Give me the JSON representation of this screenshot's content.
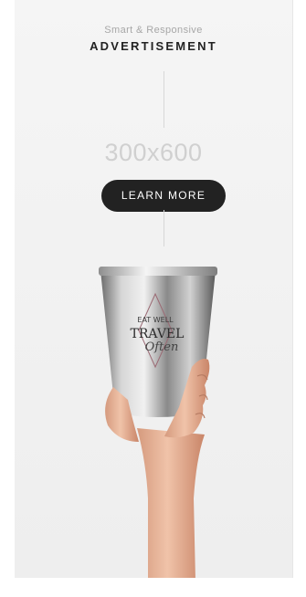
{
  "ad": {
    "kicker": "Smart & Responsive",
    "title": "ADVERTISEMENT",
    "size_label": "300x600",
    "cta_label": "LEARN MORE",
    "cup_text": {
      "line1": "EAT WELL",
      "line2": "TRAVEL",
      "line3": "Often"
    }
  },
  "colors": {
    "background": "#f2f2f2",
    "button": "#222222",
    "button_text": "#ffffff",
    "title": "#222222",
    "muted": "#a7a7a7"
  }
}
